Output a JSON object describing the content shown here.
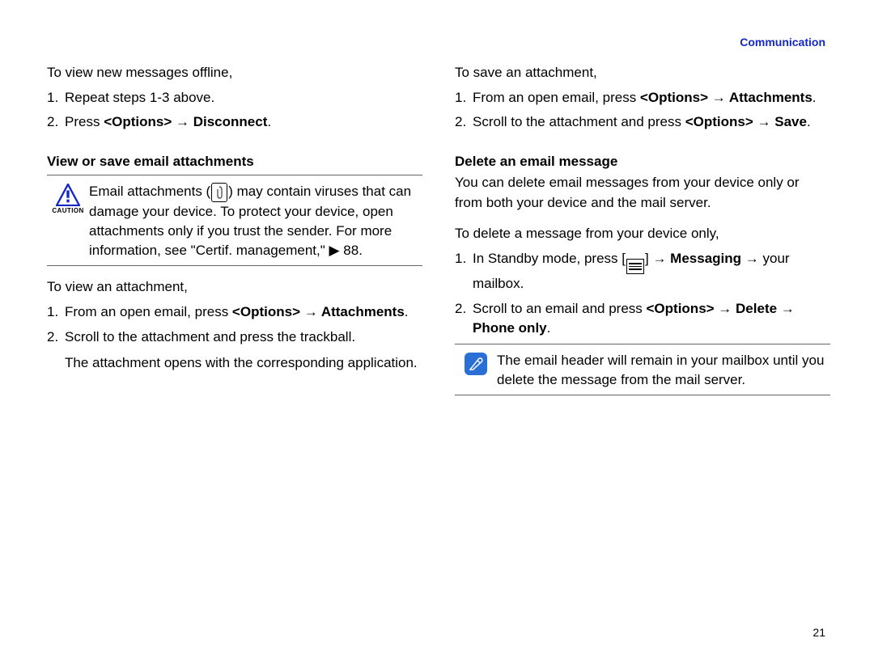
{
  "header": {
    "section": "Communication"
  },
  "page_number": "21",
  "left": {
    "intro": "To view new messages offline,",
    "step1": {
      "num": "1.",
      "text": "Repeat steps 1-3 above."
    },
    "step2": {
      "num": "2.",
      "prefix": "Press ",
      "b1": "<Options>",
      "arrow": " → ",
      "b2": "Disconnect",
      "suffix": "."
    },
    "section_title": "View or save email attachments",
    "caution": {
      "label": "CAUTION",
      "t1": "Email attachments (",
      "t2": ") may contain viruses that can damage your device. To protect your device, open attachments only if you trust the sender. For more information, see \"Certif. management,\" ",
      "t3": " 88."
    },
    "view_intro": "To view an attachment,",
    "vstep1": {
      "num": "1.",
      "prefix": "From an open email, press ",
      "b1": "<Options>",
      "arrow": " → ",
      "b2": "Attachments",
      "suffix": "."
    },
    "vstep2": {
      "num": "2.",
      "text": "Scroll to the attachment and press the trackball.",
      "sub": "The attachment opens with the corresponding application."
    }
  },
  "right": {
    "save_intro": "To save an attachment,",
    "sstep1": {
      "num": "1.",
      "prefix": "From an open email, press ",
      "b1": "<Options>",
      "arrow": " → ",
      "b2": "Attachments",
      "suffix": "."
    },
    "sstep2": {
      "num": "2.",
      "prefix": "Scroll to the attachment and press ",
      "b1": "<Options>",
      "arrow": " → ",
      "b2": "Save",
      "suffix": "."
    },
    "delete_title": "Delete an email message",
    "delete_intro": "You can delete email messages from your device only or from both your device and the mail server.",
    "delete_sub": "To delete a message from your device only,",
    "dstep1": {
      "num": "1.",
      "prefix": "In Standby mode, press [",
      "mid": "] → ",
      "b1": "Messaging",
      "arrow": " → ",
      "suffix": "your mailbox."
    },
    "dstep2": {
      "num": "2.",
      "prefix": "Scroll to an email and press ",
      "b1": "<Options>",
      "a1": " → ",
      "b2": "Delete",
      "a2": " → ",
      "b3": "Phone only",
      "suffix": "."
    },
    "note": "The email header will remain in your mailbox until you delete the message from the mail server."
  }
}
